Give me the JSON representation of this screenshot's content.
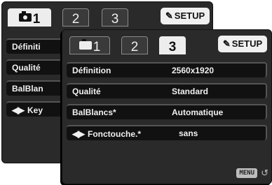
{
  "back_screen": {
    "tabs": [
      {
        "label": "1",
        "active": true,
        "icon": "camera-icon"
      },
      {
        "label": "2",
        "active": false
      },
      {
        "label": "3",
        "active": false
      }
    ],
    "setup_label": "SETUP",
    "rows": [
      {
        "name": "Définiti"
      },
      {
        "name": "Qualité"
      },
      {
        "name": "BalBlan"
      },
      {
        "name": "Key",
        "icon": "left-right-arrows-icon"
      }
    ]
  },
  "front_screen": {
    "tabs": [
      {
        "label": "1",
        "active": false,
        "icon": "camera-icon"
      },
      {
        "label": "2",
        "active": false
      },
      {
        "label": "3",
        "active": true
      }
    ],
    "setup_label": "SETUP",
    "rows": [
      {
        "name": "Définition",
        "value": "2560x1920"
      },
      {
        "name": "Qualité",
        "value": "Standard"
      },
      {
        "name": "BalBlancs*",
        "value": "Automatique"
      },
      {
        "name": "Fonctouche.*",
        "value": "sans",
        "icon": "left-right-arrows-icon"
      }
    ],
    "menu_label": "MENU"
  },
  "colors": {
    "screen_bg": "#2a2a2a",
    "row_bg": "#111111",
    "active_tab": "#ededed",
    "text": "#f0f0f0"
  }
}
